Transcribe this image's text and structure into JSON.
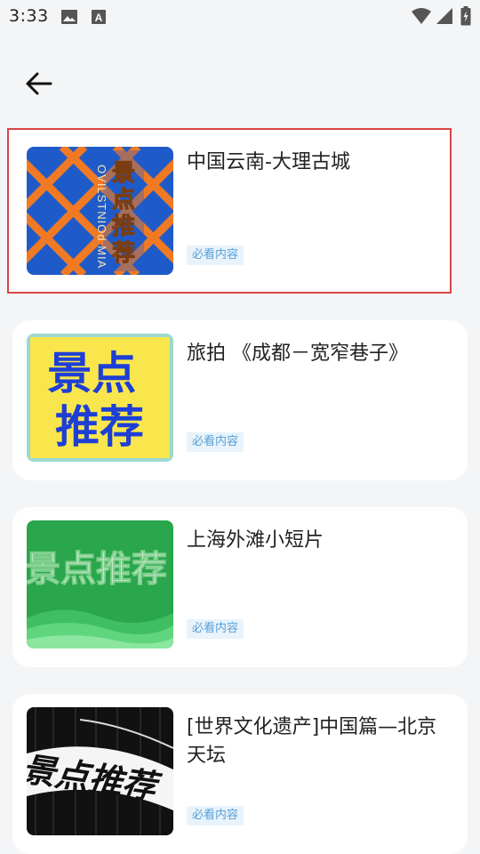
{
  "status_bar": {
    "time": "3:33",
    "icons": [
      "image-icon",
      "a-letter-icon",
      "wifi-icon",
      "signal-icon",
      "battery-icon"
    ]
  },
  "nav": {
    "back_icon": "back-arrow-icon"
  },
  "items": [
    {
      "title": "中国云南-大理古城",
      "tag": "必看内容",
      "thumb_text": "景点推荐",
      "thumb_subtext": "OVILSTNIOd MIA",
      "selected": true
    },
    {
      "title": "旅拍 《成都－宽窄巷子》",
      "tag": "必看内容",
      "thumb_text_line1": "景点",
      "thumb_text_line2": "推荐",
      "selected": false
    },
    {
      "title": "上海外滩小短片",
      "tag": "必看内容",
      "thumb_text": "景点推荐",
      "selected": false
    },
    {
      "title": "[世界文化遗产]中国篇—北京天坛",
      "tag": "必看内容",
      "thumb_text": "景点推荐",
      "selected": false
    }
  ],
  "colors": {
    "selection_border": "#d84545",
    "tag_text": "#5aa0d6",
    "tag_bg": "#e8f3fb",
    "thumb1_bg": "#1f5bc8",
    "thumb1_grid": "#f07a24",
    "thumb2_bg": "#f9e64c",
    "thumb2_text": "#1d3fd6",
    "thumb3_bg": "#2aa64c",
    "thumb4_bg": "#111111"
  }
}
